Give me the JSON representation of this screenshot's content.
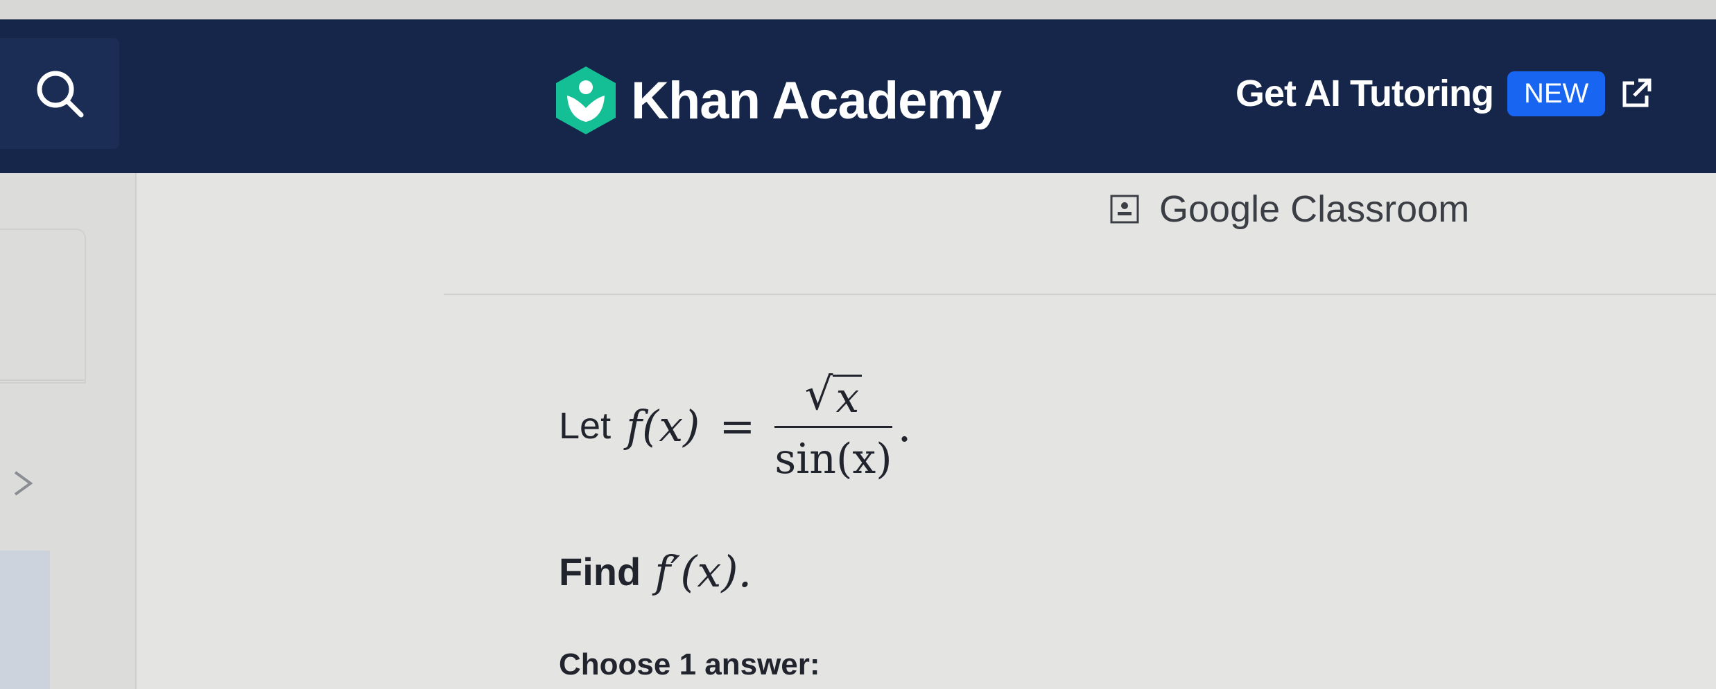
{
  "header": {
    "brand": "Khan Academy",
    "ai_link": "Get AI Tutoring",
    "badge": "NEW",
    "colors": {
      "navbar": "#15264a",
      "brand_green": "#14bf96",
      "badge_blue": "#1865f2"
    }
  },
  "toolbar": {
    "classroom_label": "Google Classroom"
  },
  "problem": {
    "intro": "Let",
    "function_lhs": "f(x)",
    "equals": "=",
    "numerator": "x",
    "denominator": "sin(x)",
    "period": ".",
    "find_label": "Find",
    "find_expression": "f′(x).",
    "choose_label": "Choose 1 answer:"
  },
  "icons": [
    "search-icon",
    "khan-academy-logo-icon",
    "external-link-icon",
    "google-classroom-icon",
    "chevron-right-icon"
  ]
}
